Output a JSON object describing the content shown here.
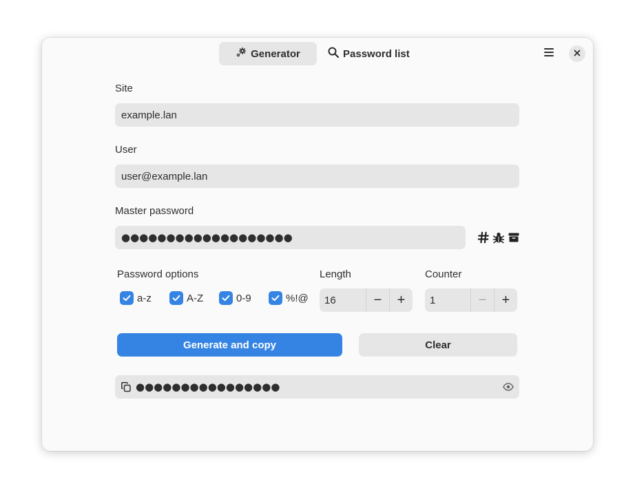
{
  "header": {
    "tabs": [
      {
        "label": "Generator",
        "icon": "gears-icon",
        "active": true
      },
      {
        "label": "Password list",
        "icon": "search-icon",
        "active": false
      }
    ],
    "menu_icon": "hamburger-menu-icon",
    "close_icon": "close-icon"
  },
  "form": {
    "site_label": "Site",
    "site_value": "example.lan",
    "user_label": "User",
    "user_value": "user@example.lan",
    "master_label": "Master password",
    "master_value": "●●●●●●●●●●●●●●●●●●●",
    "master_icons": [
      "hash-icon",
      "bug-icon",
      "archive-icon"
    ]
  },
  "options": {
    "label": "Password options",
    "checkboxes": [
      {
        "label": "a-z",
        "checked": true
      },
      {
        "label": "A-Z",
        "checked": true
      },
      {
        "label": "0-9",
        "checked": true
      },
      {
        "label": "%!@",
        "checked": true
      }
    ],
    "length_label": "Length",
    "length_value": "16",
    "counter_label": "Counter",
    "counter_value": "1",
    "minus": "−",
    "plus": "+"
  },
  "actions": {
    "generate_label": "Generate and copy",
    "clear_label": "Clear"
  },
  "output": {
    "value": "●●●●●●●●●●●●●●●●",
    "copy_icon": "copy-icon",
    "reveal_icon": "eye-icon"
  },
  "colors": {
    "accent": "#3584e4",
    "entry_bg": "#e6e6e6",
    "window_bg": "#fafafa"
  }
}
